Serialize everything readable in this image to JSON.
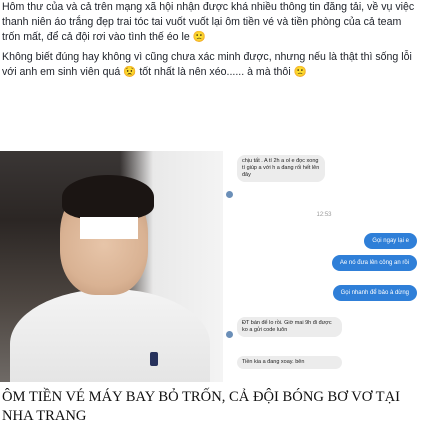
{
  "post": {
    "paragraph1": "Hôm thư của        và cả trên mạng xã hội            nhận được khá nhiều thông tin đăng tải, về vụ việc thanh niên áo trắng đẹp trai tóc tai vuốt vuốt lại ôm      tiền vé và tiền phòng của cả team trốn mất, để cả đội rơi vào tình thế éo le 🙁",
    "paragraph2": "Không biết đúng hay không vì         cũng chưa xác minh được, nhưng nếu là thật thì sống lỗi với anh em sinh viên quá 😟 tốt nhất là nên xéo...... à mà thôi 🙁"
  },
  "chat": {
    "message1": "chịu tất . A tí 2h a ol e đọc xong tí giúp a với h a đang rối hết lên đây",
    "timestamp": "12:53",
    "out1": "Gọi ngay lại e",
    "out2": "Ae nó đưa lên công an rồi",
    "out3": "Gọi nhanh để bảo à dừng",
    "message2": "ĐT bán để lo rồi. Giờ mai 9h đi được ko a gửi code luôn",
    "message3": "Tiền kia a đang xoay. bên"
  },
  "headline": "ÔM TIỀN VÉ MÁY BAY BỎ TRỐN, CẢ ĐỘI BÓNG BƠ VƠ TẠI NHA TRANG",
  "colors": {
    "outgoing_bubble": "#2f7fd8",
    "incoming_bubble": "#ececec",
    "text": "#1d2129"
  }
}
